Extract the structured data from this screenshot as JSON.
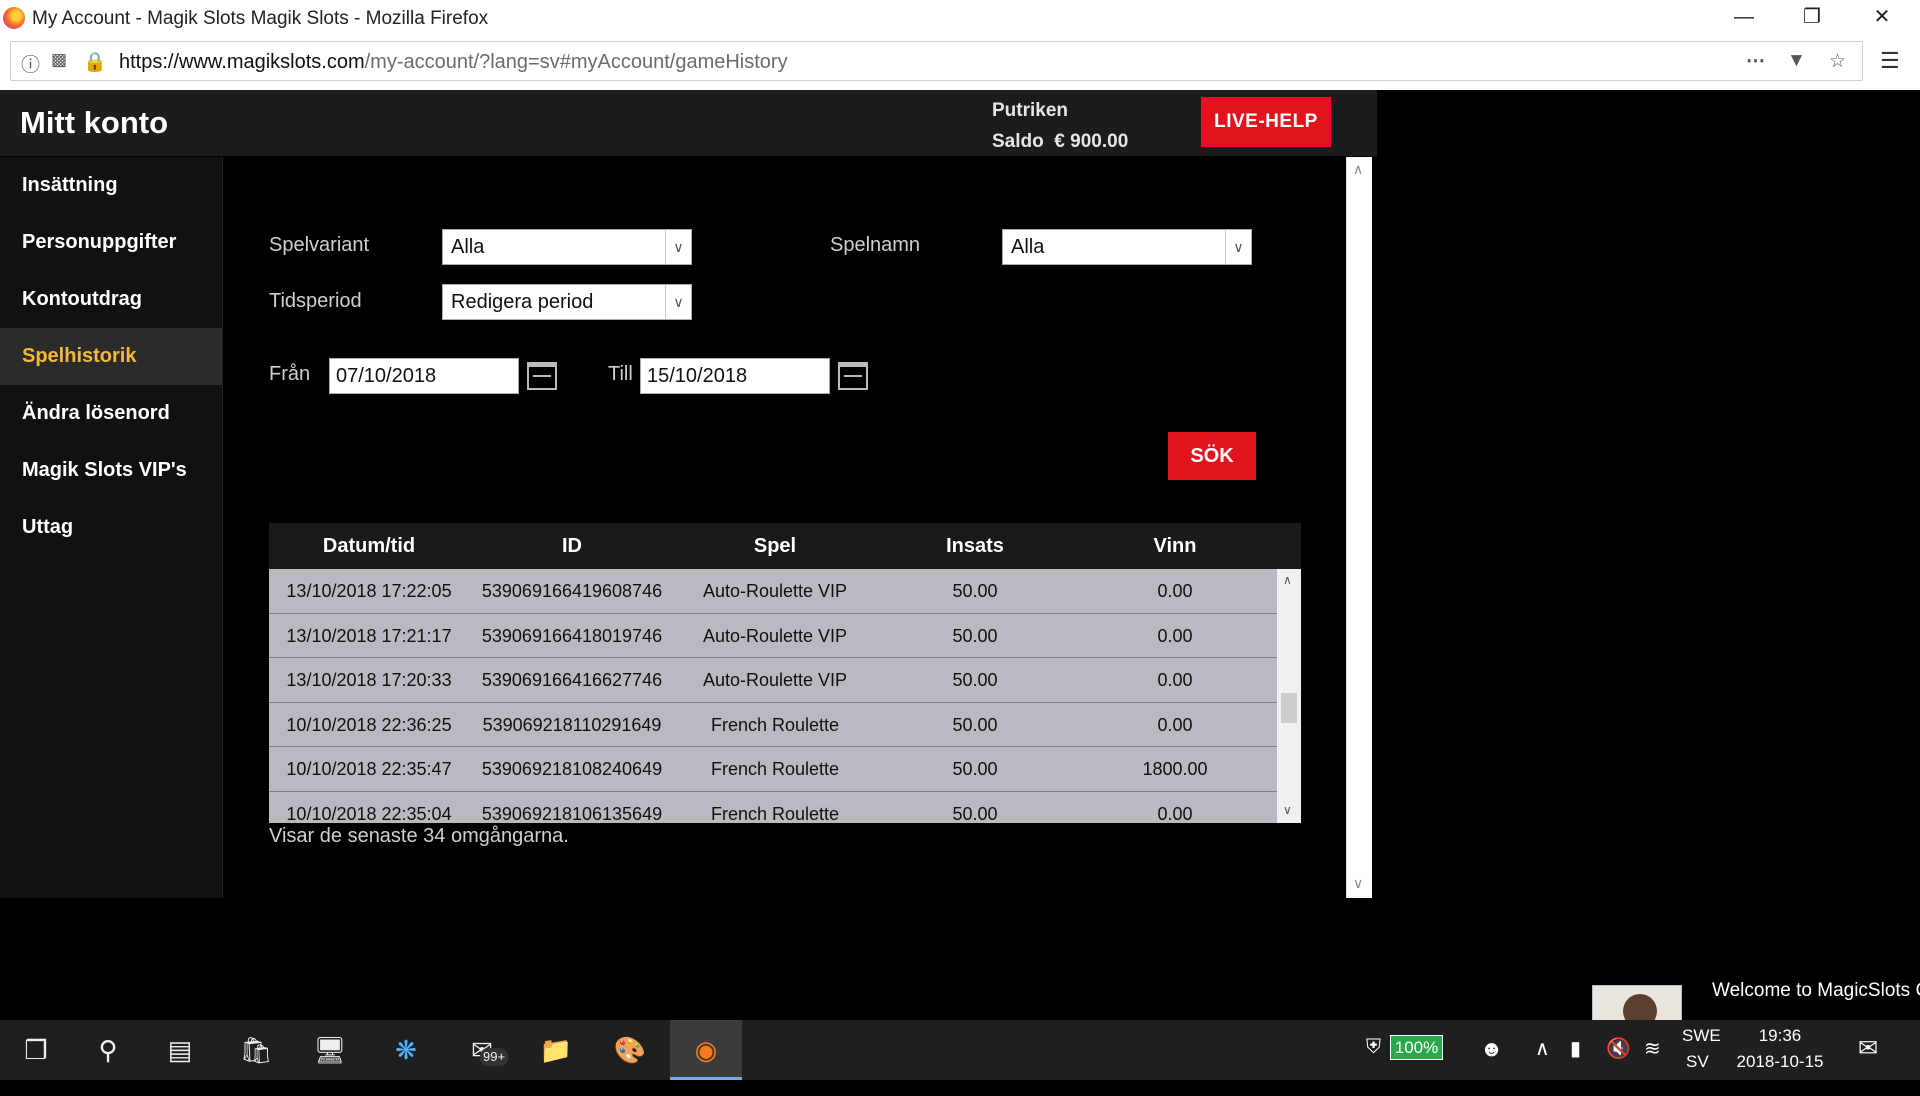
{
  "window": {
    "title": "My Account - Magik Slots Magik Slots - Mozilla Firefox"
  },
  "address": {
    "domain": "https://www.magikslots.com",
    "path": "/my-account/?lang=sv#myAccount/gameHistory"
  },
  "header": {
    "title": "Mitt konto",
    "username": "Putriken",
    "balance_label": "Saldo",
    "balance_value": "€ 900.00",
    "livehelp_label": "LIVE-HELP"
  },
  "sidebar": {
    "items": [
      {
        "label": "Insättning"
      },
      {
        "label": "Personuppgifter"
      },
      {
        "label": "Kontoutdrag"
      },
      {
        "label": "Spelhistorik",
        "active": true
      },
      {
        "label": "Ändra lösenord"
      },
      {
        "label": "Magik Slots VIP's"
      },
      {
        "label": "Uttag"
      }
    ]
  },
  "filters": {
    "variant_label": "Spelvariant",
    "variant_value": "Alla",
    "name_label": "Spelnamn",
    "name_value": "Alla",
    "period_label": "Tidsperiod",
    "period_value": "Redigera period",
    "from_label": "Från",
    "from_value": "07/10/2018",
    "to_label": "Till",
    "to_value": "15/10/2018",
    "search_label": "SÖK"
  },
  "table": {
    "columns": [
      "Datum/tid",
      "ID",
      "Spel",
      "Insats",
      "Vinn"
    ],
    "rows": [
      [
        "13/10/2018 17:22:05",
        "539069166419608746",
        "Auto-Roulette VIP",
        "50.00",
        "0.00"
      ],
      [
        "13/10/2018 17:21:17",
        "539069166418019746",
        "Auto-Roulette VIP",
        "50.00",
        "0.00"
      ],
      [
        "13/10/2018 17:20:33",
        "539069166416627746",
        "Auto-Roulette VIP",
        "50.00",
        "0.00"
      ],
      [
        "10/10/2018 22:36:25",
        "539069218110291649",
        "French Roulette",
        "50.00",
        "0.00"
      ],
      [
        "10/10/2018 22:35:47",
        "539069218108240649",
        "French Roulette",
        "50.00",
        "1800.00"
      ],
      [
        "10/10/2018 22:35:04",
        "539069218106135649",
        "French Roulette",
        "50.00",
        "0.00"
      ]
    ],
    "footnote": "Visar de senaste 34 omgångarna."
  },
  "chat": {
    "message": "Welcome to MagicSlots C"
  },
  "taskbar": {
    "badge": "99+",
    "battery": "100%",
    "lang_top": "SWE",
    "lang_bottom": "SV",
    "time": "19:36",
    "date": "2018-10-15"
  },
  "colors": {
    "accent_red": "#e1141e",
    "active_item": "#f5b839"
  }
}
